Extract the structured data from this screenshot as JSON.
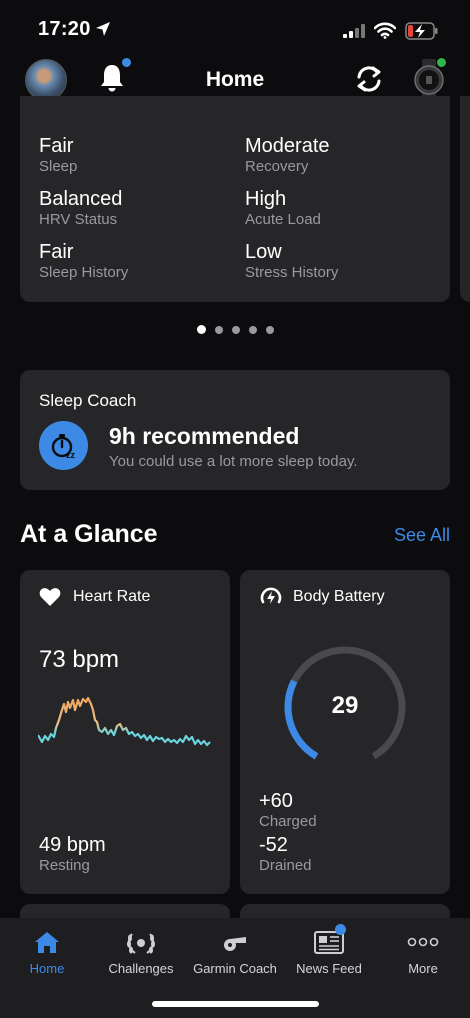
{
  "status_bar": {
    "time": "17:20"
  },
  "header": {
    "title": "Home"
  },
  "summary": {
    "metrics": [
      {
        "value": "Fair",
        "label": "Sleep"
      },
      {
        "value": "Moderate",
        "label": "Recovery"
      },
      {
        "value": "Balanced",
        "label": "HRV Status"
      },
      {
        "value": "High",
        "label": "Acute Load"
      },
      {
        "value": "Fair",
        "label": "Sleep History"
      },
      {
        "value": "Low",
        "label": "Stress History"
      }
    ],
    "page_count": 5,
    "active_page": 1
  },
  "sleep_coach": {
    "title": "Sleep Coach",
    "recommendation": "9h  recommended",
    "message": "You could use a lot more sleep today."
  },
  "glance": {
    "title": "At a Glance",
    "see_all": "See All"
  },
  "heart_rate": {
    "title": "Heart Rate",
    "current": "73 bpm",
    "resting_value": "49 bpm",
    "resting_label": "Resting"
  },
  "body_battery": {
    "title": "Body Battery",
    "value": "29",
    "level_percent": 29,
    "charged_value": "+60",
    "charged_label": "Charged",
    "drained_value": "-52",
    "drained_label": "Drained"
  },
  "tabs": [
    {
      "label": "Home",
      "icon": "home-icon",
      "active": true
    },
    {
      "label": "Challenges",
      "icon": "laurel-icon",
      "active": false
    },
    {
      "label": "Garmin Coach",
      "icon": "whistle-icon",
      "active": false
    },
    {
      "label": "News Feed",
      "icon": "newspaper-icon",
      "active": false
    },
    {
      "label": "More",
      "icon": "more-icon",
      "active": false
    }
  ],
  "colors": {
    "accent": "#3d8ae6",
    "background": "#0c0c0e",
    "card": "#262628",
    "watch_status": "#2fb84a"
  }
}
